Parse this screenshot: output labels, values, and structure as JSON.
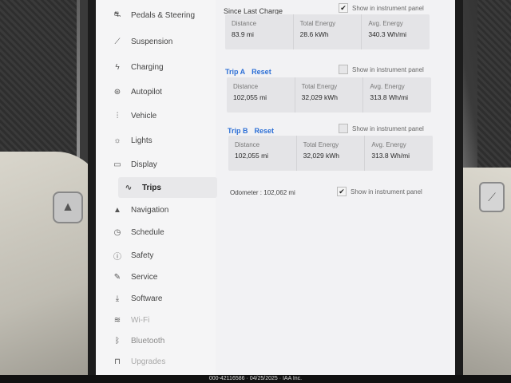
{
  "sidebar": {
    "items": [
      {
        "label": "Pedals & Steering",
        "icon": "steering-pedal-icon",
        "glyph": "⛐"
      },
      {
        "label": "Suspension",
        "icon": "wrench-suspension-icon",
        "glyph": "⟋"
      },
      {
        "label": "Charging",
        "icon": "lightning-icon",
        "glyph": "ϟ"
      },
      {
        "label": "Autopilot",
        "icon": "steering-wheel-icon",
        "glyph": "⊛"
      },
      {
        "label": "Vehicle",
        "icon": "sliders-icon",
        "glyph": "⫶"
      },
      {
        "label": "Lights",
        "icon": "sun-icon",
        "glyph": "☼"
      },
      {
        "label": "Display",
        "icon": "display-icon",
        "glyph": "▭"
      },
      {
        "label": "Trips",
        "icon": "trips-icon",
        "glyph": "∿"
      },
      {
        "label": "Navigation",
        "icon": "navigation-arrow-icon",
        "glyph": "▲"
      },
      {
        "label": "Schedule",
        "icon": "clock-icon",
        "glyph": "◷"
      },
      {
        "label": "Safety",
        "icon": "safety-icon",
        "glyph": "ⓘ"
      },
      {
        "label": "Service",
        "icon": "wrench-icon",
        "glyph": "✎"
      },
      {
        "label": "Software",
        "icon": "download-icon",
        "glyph": "⤓"
      },
      {
        "label": "Wi-Fi",
        "icon": "wifi-icon",
        "glyph": "≋"
      },
      {
        "label": "Bluetooth",
        "icon": "bluetooth-icon",
        "glyph": "ᛒ"
      },
      {
        "label": "Upgrades",
        "icon": "lock-icon",
        "glyph": "⊓"
      }
    ],
    "active": "Trips"
  },
  "since_last_charge": {
    "title": "Since Last Charge",
    "show_label": "Show in instrument panel",
    "show_checked": true,
    "distance_label": "Distance",
    "distance": "83.9 mi",
    "energy_label": "Total Energy",
    "energy": "28.6 kWh",
    "avg_label": "Avg. Energy",
    "avg": "340.3 Wh/mi"
  },
  "trip_a": {
    "title": "Trip A",
    "reset": "Reset",
    "show_label": "Show in instrument panel",
    "show_checked": false,
    "distance_label": "Distance",
    "distance": "102,055 mi",
    "energy_label": "Total Energy",
    "energy": "32,029 kWh",
    "avg_label": "Avg. Energy",
    "avg": "313.8 Wh/mi"
  },
  "trip_b": {
    "title": "Trip B",
    "reset": "Reset",
    "show_label": "Show in instrument panel",
    "show_checked": false,
    "distance_label": "Distance",
    "distance": "102,055 mi",
    "energy_label": "Total Energy",
    "energy": "32,029 kWh",
    "avg_label": "Avg. Energy",
    "avg": "313.8 Wh/mi"
  },
  "odometer": {
    "text": "Odometer : 102,062 mi",
    "show_label": "Show in instrument panel",
    "show_checked": true
  },
  "footer": "000-42116586 · 04/25/2025 · IAA Inc.",
  "colors": {
    "accent": "#2c6fd6",
    "screen_bg": "#f2f2f4",
    "card_bg": "#e4e4e7"
  }
}
